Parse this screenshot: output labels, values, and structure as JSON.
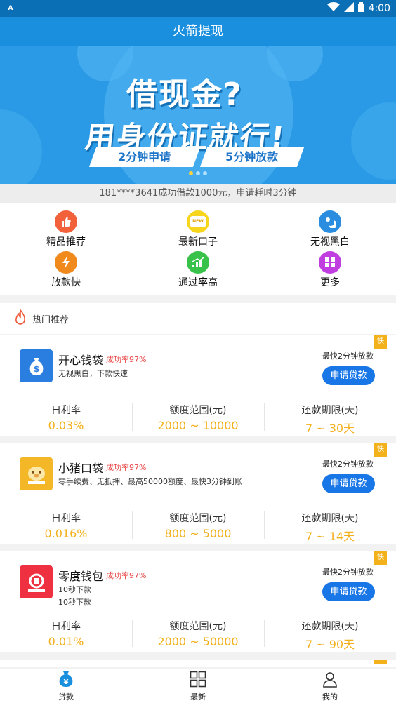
{
  "status_bar": {
    "left_icon": "A",
    "time": "4:00"
  },
  "app_title": "火箭提现",
  "banner": {
    "line1": "借现金?",
    "line2": "用身份证就行!",
    "pill1": "2分钟申请",
    "pill2": "5分钟放款",
    "active_dot": 1,
    "dot_count": 3
  },
  "ticker": "181****3641成功借款1000元，申请耗时3分钟",
  "categories": [
    {
      "label": "精品推荐",
      "icon": "thumbs-up-icon",
      "color": "#f2613a"
    },
    {
      "label": "最新口子",
      "icon": "new-badge-icon",
      "color": "#f7d51d"
    },
    {
      "label": "无视黑白",
      "icon": "sun-moon-icon",
      "color": "#2a8de0"
    },
    {
      "label": "放款快",
      "icon": "lightning-icon",
      "color": "#f08a1c"
    },
    {
      "label": "通过率高",
      "icon": "trend-chart-icon",
      "color": "#38c24a"
    },
    {
      "label": "更多",
      "icon": "grid-more-icon",
      "color": "#c03de0"
    }
  ],
  "hot_section_title": "热门推荐",
  "products": [
    {
      "name": "开心钱袋",
      "success_rate": "成功率97%",
      "desc_lines": [
        "无视黑白，下款快速"
      ],
      "fast_label": "最快2分钟放款",
      "apply_label": "申请贷款",
      "tag": "快",
      "logo_color": "#2a7ee0",
      "logo_text": "$",
      "stats": [
        {
          "key": "日利率",
          "value": "0.03%"
        },
        {
          "key": "额度范围(元)",
          "value": "2000 ~ 10000"
        },
        {
          "key": "还款期限(天)",
          "value": "7 ~ 30天"
        }
      ]
    },
    {
      "name": "小猪口袋",
      "success_rate": "成功率97%",
      "desc_lines": [
        "零手续费、无抵押、最高50000额度、最快3分钟到账"
      ],
      "fast_label": "最快2分钟放款",
      "apply_label": "申请贷款",
      "tag": "快",
      "logo_color": "#f4b728",
      "logo_text": "猪",
      "stats": [
        {
          "key": "日利率",
          "value": "0.016%"
        },
        {
          "key": "额度范围(元)",
          "value": "800 ~ 5000"
        },
        {
          "key": "还款期限(天)",
          "value": "7 ~ 14天"
        }
      ]
    },
    {
      "name": "零度钱包",
      "success_rate": "成功率97%",
      "desc_lines": [
        "10秒下款",
        "10秒下款"
      ],
      "fast_label": "最快2分钟放款",
      "apply_label": "申请贷款",
      "tag": "快",
      "logo_color": "#ee3041",
      "logo_text": "0",
      "stats": [
        {
          "key": "日利率",
          "value": "0.01%"
        },
        {
          "key": "额度范围(元)",
          "value": "2000 ~ 50000"
        },
        {
          "key": "还款期限(天)",
          "value": "7 ~ 90天"
        }
      ]
    }
  ],
  "tabs": [
    {
      "label": "贷款",
      "icon": "loan-yen-icon",
      "active": true
    },
    {
      "label": "最新",
      "icon": "grid-icon",
      "active": false
    },
    {
      "label": "我的",
      "icon": "person-icon",
      "active": false
    }
  ]
}
